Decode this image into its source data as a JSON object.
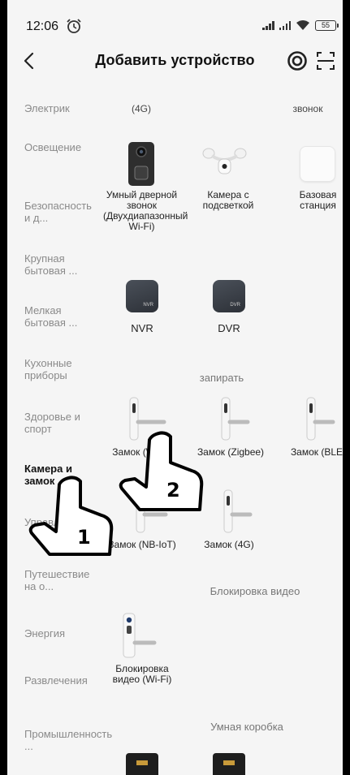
{
  "status_bar": {
    "time": "12:06",
    "battery": "55"
  },
  "header": {
    "title": "Добавить устройство",
    "icons": [
      "back-arrow-icon",
      "target-icon",
      "scan-icon"
    ]
  },
  "sidebar": {
    "items": [
      {
        "label": "Электрик",
        "active": false
      },
      {
        "label": "Освещение",
        "active": false
      },
      {
        "label": "Безопасность и д...",
        "active": false
      },
      {
        "label": "Крупная бытовая ...",
        "active": false
      },
      {
        "label": "Мелкая бытовая ...",
        "active": false
      },
      {
        "label": "Кухонные приборы",
        "active": false
      },
      {
        "label": "Здоровье и спорт",
        "active": false
      },
      {
        "label": "Камера и замок",
        "active": true
      },
      {
        "label": "Управление ...",
        "active": false
      },
      {
        "label": "Путешествие на о...",
        "active": false
      },
      {
        "label": "Энергия",
        "active": false
      },
      {
        "label": "Развлечения",
        "active": false
      },
      {
        "label": "Промышленность ...",
        "active": false
      }
    ]
  },
  "content": {
    "top_partial": {
      "left": "(4G)",
      "right": "звонок"
    },
    "row1": [
      {
        "label": "Умный дверной звонок (Двухдиапазонный Wi-Fi)",
        "icon": "doorbell-icon"
      },
      {
        "label": "Камера с подсветкой",
        "icon": "floodlight-camera-icon"
      },
      {
        "label": "Базовая станция",
        "icon": "base-station-icon"
      }
    ],
    "row2": [
      {
        "label": "NVR",
        "icon": "nvr-icon",
        "badge": "NVR"
      },
      {
        "label": "DVR",
        "icon": "dvr-icon",
        "badge": "DVR"
      }
    ],
    "section_lock": "запирать",
    "locks_row1": [
      {
        "label": "Замок (Wi-Fi)"
      },
      {
        "label": "Замок (Zigbee)"
      },
      {
        "label": "Замок (BLE)"
      }
    ],
    "locks_row2": [
      {
        "label": "Замок (NB-IoT)"
      },
      {
        "label": "Замок (4G)"
      }
    ],
    "section_video_lock": "Блокировка видео",
    "video_lock": [
      {
        "label": "Блокировка видео (Wi-Fi)"
      }
    ],
    "section_smart_box": "Умная коробка"
  },
  "overlays": {
    "hand1": "1",
    "hand2": "2"
  },
  "colors": {
    "background": "#f5f5f5",
    "active_text": "#111111",
    "inactive_text": "#8a8a8a",
    "tile_dark": "#3a3f47"
  }
}
